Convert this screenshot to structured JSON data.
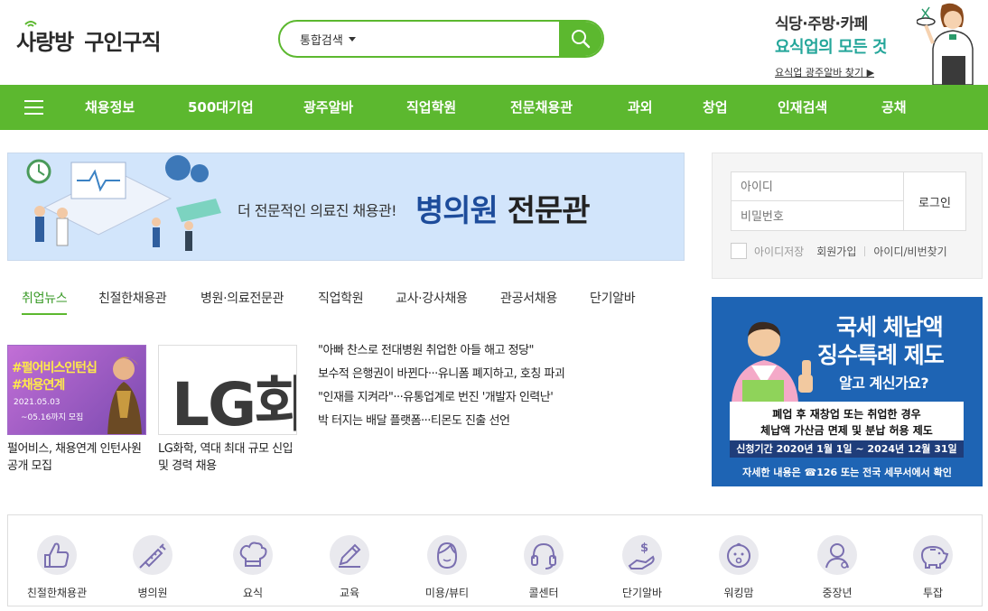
{
  "header": {
    "logo_main_a": "사랑방",
    "logo_main_b": "구인구직",
    "search": {
      "select_label": "통합검색",
      "input_placeholder": ""
    },
    "promo": {
      "line1": "식당·주방·카페",
      "line2": "요식업의 모든 것",
      "link": "요식업 광주알바 찾기 ▶"
    }
  },
  "nav": {
    "items": [
      "채용정보",
      "500대기업",
      "광주알바",
      "직업학원",
      "전문채용관",
      "과외",
      "창업",
      "인재검색",
      "공채"
    ]
  },
  "banner": {
    "subtitle": "더 전문적인 의료진 채용관!",
    "title_a": "병의원",
    "title_b": "전문관"
  },
  "login": {
    "id_placeholder": "아이디",
    "pw_placeholder": "비밀번호",
    "button": "로그인",
    "save_id": "아이디저장",
    "join": "회원가입",
    "find": "아이디/비번찾기"
  },
  "news_tabs": [
    "취업뉴스",
    "친절한채용관",
    "병원·의료전문관",
    "직업학원",
    "교사·강사채용",
    "관공서채용",
    "단기알바"
  ],
  "news_cards": [
    {
      "img_line1": "#펄어비스인턴십",
      "img_line2": "#채용연계",
      "img_date1": "2021.05.03",
      "img_date2": "~05.16까지 모집",
      "caption": "펄어비스, 채용연계 인턴사원 공개 모집"
    },
    {
      "img_text": "LG화",
      "caption": "LG화학, 역대 최대 규모 신입 및 경력 채용"
    }
  ],
  "headlines": [
    "\"아빠 찬스로 전대병원 취업한 아들 해고 정당\"",
    "보수적 은행권이 바뀐다···유니폼 폐지하고, 호칭 파괴",
    "\"인재를 지켜라\"···유통업계로 번진 '개발자 인력난'",
    "박 터지는 배달 플랫폼···티몬도 진출 선언"
  ],
  "ad": {
    "title1": "국세 체납액",
    "title2": "징수특례 제도",
    "subtitle": "알고 계신가요?",
    "box_line1": "폐업 후 재창업 또는 취업한 경우",
    "box_line2": "체납액 가산금 면제 및 분납 허용 제도",
    "period": "신청기간 2020년 1월 1일 ~ 2024년 12월 31일",
    "footer": "자세한 내용은 ☎126 또는 전국 세무서에서 확인"
  },
  "categories": [
    {
      "label": "친절한채용관",
      "icon": "thumbs-up-icon"
    },
    {
      "label": "병의원",
      "icon": "syringe-icon"
    },
    {
      "label": "요식",
      "icon": "chef-hat-icon"
    },
    {
      "label": "교육",
      "icon": "pencil-icon"
    },
    {
      "label": "미용/뷰티",
      "icon": "face-icon"
    },
    {
      "label": "콜센터",
      "icon": "headset-icon"
    },
    {
      "label": "단기알바",
      "icon": "money-hand-icon"
    },
    {
      "label": "워킹맘",
      "icon": "baby-icon"
    },
    {
      "label": "중장년",
      "icon": "senior-icon"
    },
    {
      "label": "투잡",
      "icon": "piggy-bank-icon"
    }
  ],
  "colors": {
    "brand_green": "#5cb82f",
    "ad_blue": "#1e64b4",
    "banner_blue": "#d2e5fb",
    "icon_purple": "#7a6fb0"
  }
}
